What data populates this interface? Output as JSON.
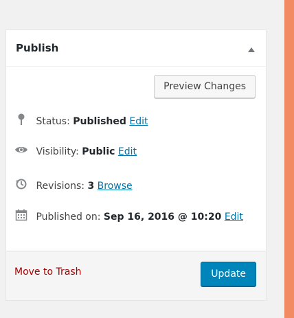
{
  "publish_box": {
    "title": "Publish",
    "preview_button": "Preview Changes",
    "status": {
      "label": "Status:",
      "value": "Published",
      "edit": "Edit"
    },
    "visibility": {
      "label": "Visibility:",
      "value": "Public",
      "edit": "Edit"
    },
    "revisions": {
      "label": "Revisions:",
      "value": "3",
      "browse": "Browse"
    },
    "published_on": {
      "label": "Published on:",
      "value": "Sep 16, 2016 @ 10:20",
      "edit": "Edit"
    },
    "trash_link": "Move to Trash",
    "update_button": "Update"
  },
  "colors": {
    "link": "#0073aa",
    "trash": "#aa0000",
    "primary_button": "#0085ba",
    "accent_bar": "#f28a62"
  },
  "icons": [
    "pin-icon",
    "eye-icon",
    "revisions-icon",
    "calendar-icon",
    "collapse-arrow-icon"
  ]
}
